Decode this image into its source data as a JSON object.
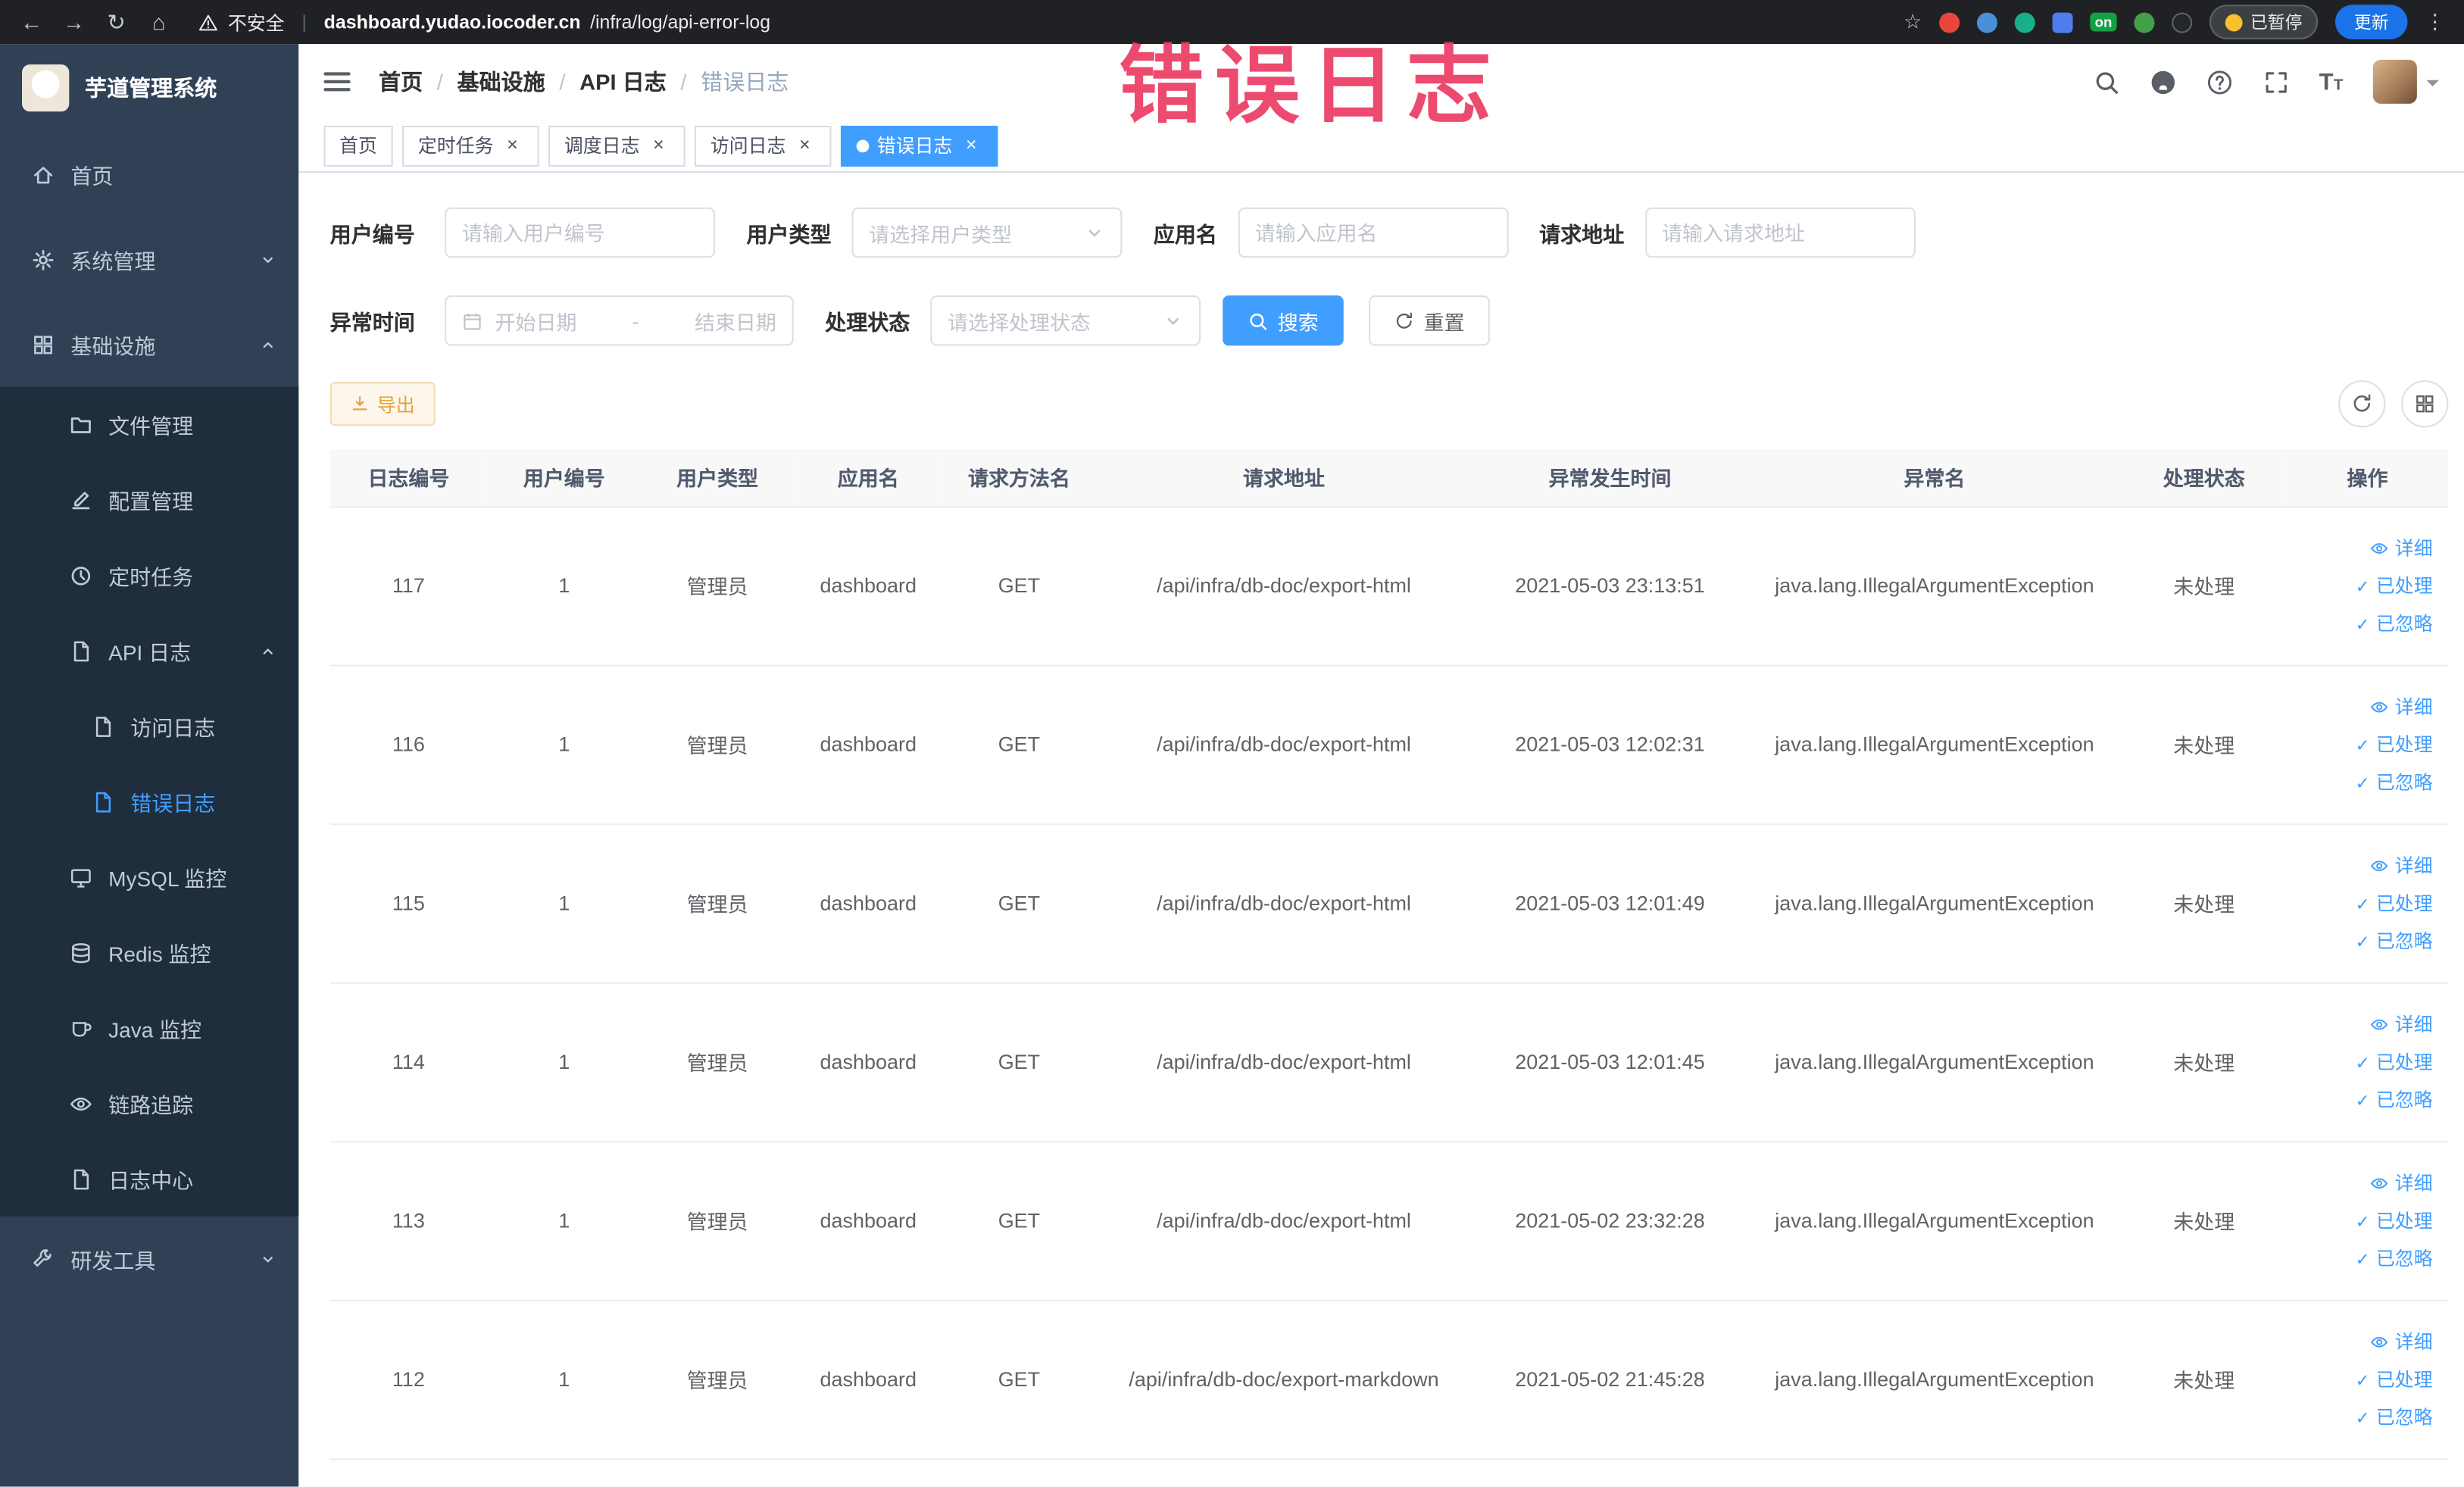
{
  "watermark": "错误日志",
  "browser": {
    "security_label": "不安全",
    "url_domain": "dashboard.yudao.iocoder.cn",
    "url_path": "/infra/log/api-error-log",
    "paused_badge": "已暂停",
    "update_button": "更新",
    "extension_on_badge": "on"
  },
  "sidebar": {
    "logo_title": "芋道管理系统",
    "items": {
      "home": "首页",
      "system": "系统管理",
      "infra": "基础设施",
      "file": "文件管理",
      "config": "配置管理",
      "job": "定时任务",
      "api_log": "API 日志",
      "access_log": "访问日志",
      "error_log": "错误日志",
      "mysql": "MySQL 监控",
      "redis": "Redis 监控",
      "java": "Java 监控",
      "trace": "链路追踪",
      "log_center": "日志中心",
      "devtools": "研发工具"
    }
  },
  "header": {
    "breadcrumb": [
      "首页",
      "基础设施",
      "API 日志",
      "错误日志"
    ]
  },
  "tabs": [
    {
      "label": "首页",
      "closable": false,
      "active": false
    },
    {
      "label": "定时任务",
      "closable": true,
      "active": false
    },
    {
      "label": "调度日志",
      "closable": true,
      "active": false
    },
    {
      "label": "访问日志",
      "closable": true,
      "active": false
    },
    {
      "label": "错误日志",
      "closable": true,
      "active": true
    }
  ],
  "filters": {
    "user_id_label": "用户编号",
    "user_id_placeholder": "请输入用户编号",
    "user_type_label": "用户类型",
    "user_type_placeholder": "请选择用户类型",
    "app_name_label": "应用名",
    "app_name_placeholder": "请输入应用名",
    "request_url_label": "请求地址",
    "request_url_placeholder": "请输入请求地址",
    "exception_time_label": "异常时间",
    "date_start_placeholder": "开始日期",
    "date_separator": "-",
    "date_end_placeholder": "结束日期",
    "status_label": "处理状态",
    "status_placeholder": "请选择处理状态",
    "search_button": "搜索",
    "reset_button": "重置"
  },
  "toolbar": {
    "export_button": "导出"
  },
  "table": {
    "headers": [
      "日志编号",
      "用户编号",
      "用户类型",
      "应用名",
      "请求方法名",
      "请求地址",
      "异常发生时间",
      "异常名",
      "处理状态",
      "操作"
    ],
    "row_actions": [
      "详细",
      "已处理",
      "已忽略"
    ],
    "rows": [
      {
        "id": "117",
        "user_id": "1",
        "user_type": "管理员",
        "app": "dashboard",
        "method": "GET",
        "url": "/api/infra/db-doc/export-html",
        "time": "2021-05-03 23:13:51",
        "exception": "java.lang.IllegalArgumentException",
        "status": "未处理"
      },
      {
        "id": "116",
        "user_id": "1",
        "user_type": "管理员",
        "app": "dashboard",
        "method": "GET",
        "url": "/api/infra/db-doc/export-html",
        "time": "2021-05-03 12:02:31",
        "exception": "java.lang.IllegalArgumentException",
        "status": "未处理"
      },
      {
        "id": "115",
        "user_id": "1",
        "user_type": "管理员",
        "app": "dashboard",
        "method": "GET",
        "url": "/api/infra/db-doc/export-html",
        "time": "2021-05-03 12:01:49",
        "exception": "java.lang.IllegalArgumentException",
        "status": "未处理"
      },
      {
        "id": "114",
        "user_id": "1",
        "user_type": "管理员",
        "app": "dashboard",
        "method": "GET",
        "url": "/api/infra/db-doc/export-html",
        "time": "2021-05-03 12:01:45",
        "exception": "java.lang.IllegalArgumentException",
        "status": "未处理"
      },
      {
        "id": "113",
        "user_id": "1",
        "user_type": "管理员",
        "app": "dashboard",
        "method": "GET",
        "url": "/api/infra/db-doc/export-html",
        "time": "2021-05-02 23:32:28",
        "exception": "java.lang.IllegalArgumentException",
        "status": "未处理"
      },
      {
        "id": "112",
        "user_id": "1",
        "user_type": "管理员",
        "app": "dashboard",
        "method": "GET",
        "url": "/api/infra/db-doc/export-markdown",
        "time": "2021-05-02 21:45:28",
        "exception": "java.lang.IllegalArgumentException",
        "status": "未处理"
      }
    ]
  },
  "colors": {
    "accent": "#409eff",
    "warning": "#e6a23c",
    "sidebar_bg": "#304156",
    "submenu_bg": "#1f2d3d",
    "watermark_red": "#ec3b63"
  }
}
